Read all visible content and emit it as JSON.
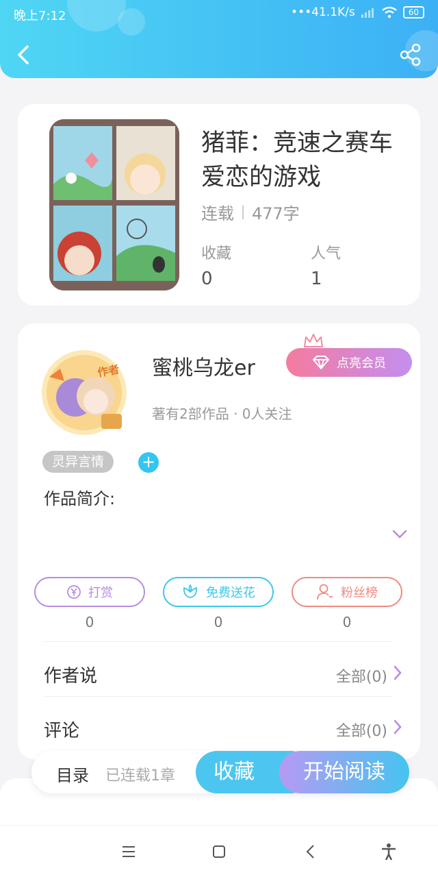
{
  "status_bar": {
    "time": "晚上7:12",
    "net": "•••41.1K/s",
    "battery": "60"
  },
  "book": {
    "title": "猪菲：竞速之赛车爱恋的游戏",
    "status": "连载",
    "words": "477字",
    "favorites_label": "收藏",
    "favorites_value": "0",
    "popularity_label": "人气",
    "popularity_value": "1"
  },
  "author": {
    "name": "蜜桃乌龙er",
    "avatar_badge": "作者",
    "vip_label": "点亮会员",
    "works": "著有2部作品 · 0人关注"
  },
  "tag": "灵异言情",
  "plus": "+",
  "intro_label": "作品简介:",
  "actions": [
    {
      "label": "打赏",
      "count": "0"
    },
    {
      "label": "免费送花",
      "count": "0"
    },
    {
      "label": "粉丝榜",
      "count": "0"
    }
  ],
  "author_says": {
    "label": "作者说",
    "right": "全部(0)"
  },
  "comments": {
    "label": "评论",
    "right": "全部(0)"
  },
  "bottom": {
    "toc": "目录",
    "serial": "已连载1章",
    "fav": "收藏",
    "read": "开始阅读"
  },
  "colors": {
    "header_start": "#4fd6f4",
    "header_end": "#3cb0f5",
    "accent": "#33c6f0",
    "reward": "#b58be6",
    "flower": "#3cc8ea",
    "fans": "#f08a80"
  }
}
